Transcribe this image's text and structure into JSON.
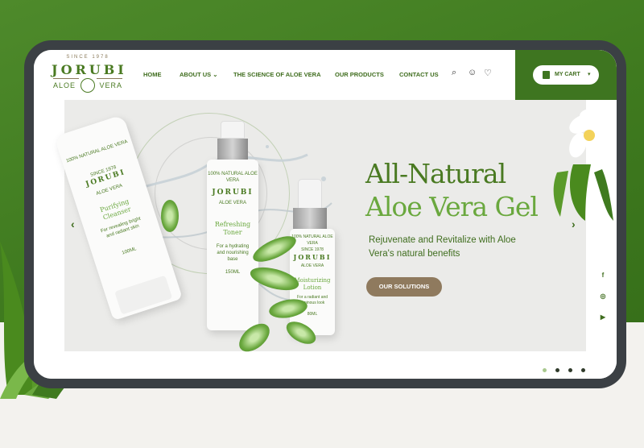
{
  "brand": {
    "since": "SINCE 1978",
    "name": "JORUBI",
    "sub_left": "ALOE",
    "sub_right": "VERA"
  },
  "nav": {
    "items": [
      {
        "label": "HOME"
      },
      {
        "label": "ABOUT US ⌄"
      },
      {
        "label": "THE SCIENCE OF ALOE VERA"
      },
      {
        "label": "OUR PRODUCTS"
      },
      {
        "label": "CONTACT US"
      }
    ],
    "icons": [
      "search-icon",
      "user-icon",
      "heart-icon"
    ],
    "icon_glyphs": {
      "search": "⌕",
      "user": "☺",
      "heart": "♡"
    }
  },
  "cart": {
    "label": "MY CART",
    "caret": "▾"
  },
  "hero": {
    "title_line1": "All-Natural",
    "title_line2": "Aloe Vera Gel",
    "subtitle": "Rejuvenate and Revitalize with Aloe Vera's natural benefits",
    "cta": "OUR SOLUTIONS",
    "prev": "‹",
    "next": "›"
  },
  "products": [
    {
      "natural": "100% NATURAL ALOE VERA",
      "brand": "JORUBI",
      "since": "SINCE 1978",
      "aloe_vera": "ALOE VERA",
      "name": "Purifying Cleanser",
      "desc": "For revealing bright and radiant skin",
      "volume": "100ML"
    },
    {
      "natural": "100% NATURAL ALOE VERA",
      "brand": "JORUBI",
      "aloe_vera": "ALOE VERA",
      "name": "Refreshing Toner",
      "desc": "For a hydrating and nourishing base",
      "volume": "150ML"
    },
    {
      "natural": "100% NATURAL ALOE VERA",
      "brand": "JORUBI",
      "since": "SINCE 1978",
      "aloe_vera": "ALOE VERA",
      "name": "Moisturizing Lotion",
      "desc": "For a radiant and luminous look",
      "volume": "80ML"
    }
  ],
  "social": {
    "facebook": "f",
    "instagram": "◎",
    "youtube": "▶"
  },
  "slider": {
    "count": 4,
    "active": 1
  },
  "colors": {
    "brand_green": "#3e7520",
    "light_green": "#6aa83e",
    "cta_brown": "#8f7a5e",
    "frame": "#3b4044"
  }
}
